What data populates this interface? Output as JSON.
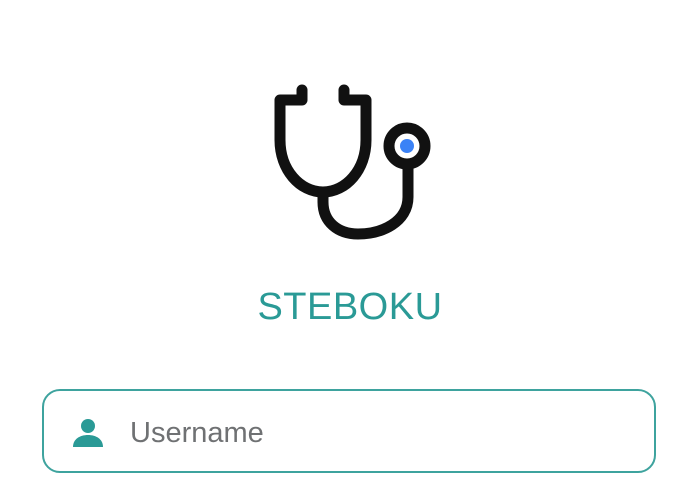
{
  "app": {
    "title": "STEBOKU"
  },
  "login": {
    "username": {
      "value": "",
      "placeholder": "Username"
    }
  },
  "icons": {
    "logo": "stethoscope-icon",
    "username": "user-icon"
  },
  "colors": {
    "accent": "#2a9a96",
    "field_border": "#3ea39e",
    "logo_stroke": "#111111",
    "logo_dot": "#3b82f6",
    "placeholder": "#6f7173"
  }
}
